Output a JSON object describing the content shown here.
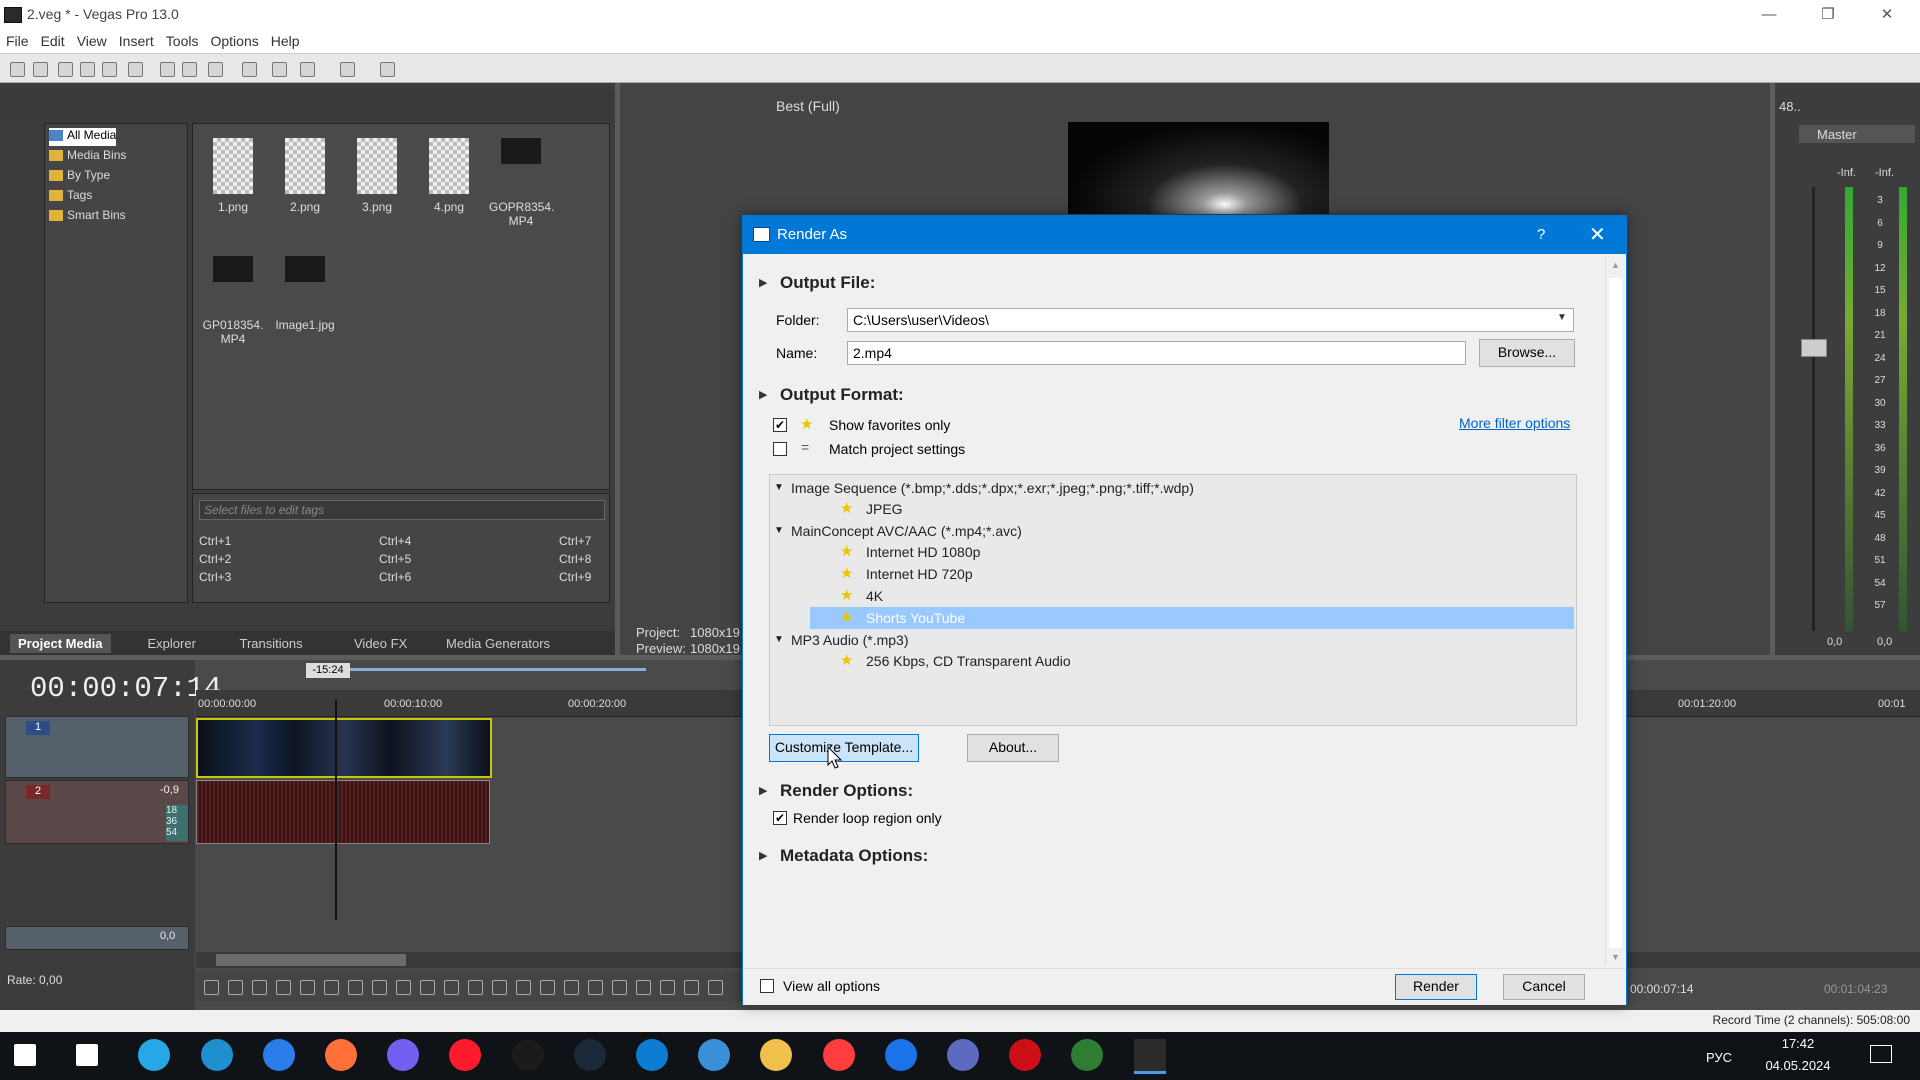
{
  "window": {
    "title": "2.veg * - Vegas Pro 13.0"
  },
  "menu": [
    "File",
    "Edit",
    "View",
    "Insert",
    "Tools",
    "Options",
    "Help"
  ],
  "preview": {
    "quality": "Best (Full)",
    "project_label": "Project:",
    "project_value": "1080x19",
    "preview_label": "Preview:",
    "preview_value": "1080x19"
  },
  "media_tree": [
    "All Media",
    "Media Bins",
    "By Type",
    "Tags",
    "Smart Bins"
  ],
  "media_files": [
    "1.png",
    "2.png",
    "3.png",
    "4.png",
    "GOPR8354.\nMP4",
    "GP018354.\nMP4",
    "Image1.jpg"
  ],
  "tags": {
    "placeholder": "Select files to edit tags",
    "shortcuts": [
      "Ctrl+1",
      "Ctrl+4",
      "Ctrl+7",
      "Ctrl+2",
      "Ctrl+5",
      "Ctrl+8",
      "Ctrl+3",
      "Ctrl+6",
      "Ctrl+9"
    ]
  },
  "tabs": [
    "Project Media",
    "Explorer",
    "Transitions",
    "Video FX",
    "Media Generators"
  ],
  "timeline": {
    "timecode": "00:00:07:14",
    "marker": "-15:24",
    "ruler": [
      "00:00:00:00",
      "00:00:10:00",
      "00:00:20:00",
      "00:01:20:00",
      "00:01"
    ],
    "track1": "1",
    "track2": "2",
    "vol": "-0,9",
    "master_vol": "0,0",
    "rate": "Rate: 0,00",
    "audio_levels": [
      "18",
      "36",
      "54"
    ]
  },
  "status": {
    "time1": "00:00:07:14",
    "time2": "00:01:04:23",
    "record": "Record Time (2 channels): 505:08:00"
  },
  "mixer": {
    "title": "Master",
    "label_top": "48..",
    "inf_l": "-Inf.",
    "inf_r": "-Inf.",
    "scale": [
      "3",
      "6",
      "9",
      "12",
      "15",
      "18",
      "21",
      "24",
      "27",
      "30",
      "33",
      "36",
      "39",
      "42",
      "45",
      "48",
      "51",
      "54",
      "57"
    ],
    "bottom_l": "0,0",
    "bottom_r": "0,0"
  },
  "dialog": {
    "title": "Render As",
    "help": "?",
    "output_file": "Output File:",
    "folder_label": "Folder:",
    "folder_value": "C:\\Users\\user\\Videos\\",
    "name_label": "Name:",
    "name_value": "2.mp4",
    "browse": "Browse...",
    "output_format": "Output Format:",
    "show_favorites": "Show favorites only",
    "match_project": "Match project settings",
    "more_filter": "More filter options",
    "tree": [
      {
        "label": "Image Sequence (*.bmp;*.dds;*.dpx;*.exr;*.jpeg;*.png;*.tiff;*.wdp)",
        "items": [
          "JPEG"
        ]
      },
      {
        "label": "MainConcept AVC/AAC (*.mp4;*.avc)",
        "items": [
          "Internet HD 1080p",
          "Internet HD 720p",
          "4K",
          "Shorts YouTube"
        ]
      },
      {
        "label": "MP3 Audio (*.mp3)",
        "items": [
          "256 Kbps, CD Transparent Audio"
        ]
      }
    ],
    "selected": "Shorts YouTube",
    "customize": "Customize Template...",
    "about": "About...",
    "render_options": "Render Options:",
    "loop_only": "Render loop region only",
    "metadata": "Metadata Options:",
    "view_all": "View all options",
    "render": "Render",
    "cancel": "Cancel"
  },
  "taskbar": {
    "lang": "РУС",
    "time": "17:42",
    "date": "04.05.2024"
  },
  "colors": {
    "accent": "#0078d7",
    "selection": "#99c9ff",
    "star": "#e8c500"
  }
}
